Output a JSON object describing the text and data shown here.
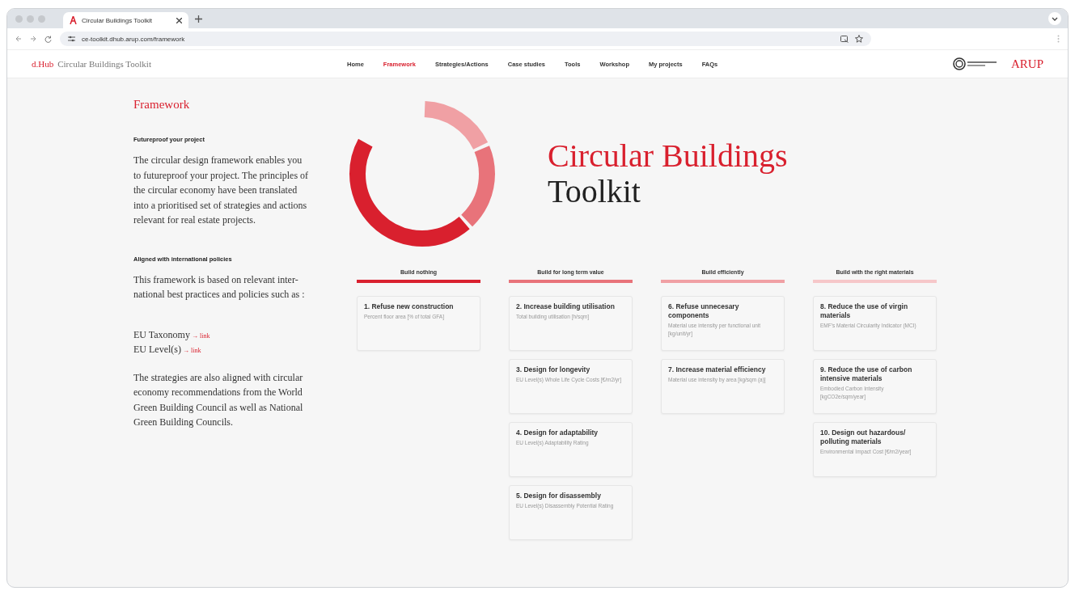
{
  "browser": {
    "tab_title": "Circular Buildings Toolkit",
    "url": "ce-toolkit.dhub.arup.com/framework"
  },
  "header": {
    "brand_mark": "d.Hub",
    "brand_title": "Circular Buildings Toolkit",
    "nav": [
      {
        "label": "Home",
        "selected": false
      },
      {
        "label": "Framework",
        "selected": true
      },
      {
        "label": "Strategies/Actions",
        "selected": false
      },
      {
        "label": "Case studies",
        "selected": false
      },
      {
        "label": "Tools",
        "selected": false
      },
      {
        "label": "Workshop",
        "selected": false
      },
      {
        "label": "My projects",
        "selected": false
      },
      {
        "label": "FAQs",
        "selected": false
      }
    ],
    "company": "ARUP"
  },
  "sidebar": {
    "heading": "Framework",
    "sections": [
      {
        "kind": "subheading",
        "text": "Futureproof your project"
      },
      {
        "kind": "paragraph",
        "text": "The circular design framework enables you to futureproof your project. The principles of the circular economy have been translated into a prioritised set of strategies and actions relevant for real estate projects."
      },
      {
        "kind": "subheading",
        "text": "Aligned with international policies"
      },
      {
        "kind": "paragraph",
        "text": "This framework is based on relevant inter-national best practices and policies such as :"
      },
      {
        "kind": "link",
        "text": "EU Taxonomy",
        "link": "→ link"
      },
      {
        "kind": "link",
        "text": "EU Level(s)",
        "link": "→ link"
      },
      {
        "kind": "paragraph",
        "text": "The strategies are also aligned with circular economy recommendations from the World Green Building Council as well as National Green Building Councils."
      }
    ]
  },
  "hero": {
    "title_line_1": "Circular Buildings",
    "title_line_2": "Toolkit"
  },
  "columns": [
    {
      "title": "Build nothing",
      "color": "#d9202e",
      "cards": [
        {
          "title": "1. Refuse new construction",
          "metric": "Percent floor area [% of total GFA]"
        }
      ]
    },
    {
      "title": "Build for long term value",
      "color": "#e8737a",
      "cards": [
        {
          "title": "2. Increase building utilisation",
          "metric": "Total building utilisation [h/sqm]"
        },
        {
          "title": "3. Design for longevity",
          "metric": "EU Level(s) Whole Life Cycle Costs [€/m2/yr]"
        },
        {
          "title": "4. Design for adaptability",
          "metric": "EU Level(s) Adaptability Rating"
        },
        {
          "title": "5. Design for disassembly",
          "metric": "EU Level(s) Disassembly Potential Rating"
        }
      ]
    },
    {
      "title": "Build efficiently",
      "color": "#f0a0a4",
      "cards": [
        {
          "title": "6. Refuse unnecesary components",
          "metric": "Material use intensity per functional unit [kg/unit/yr]"
        },
        {
          "title": "7. Increase material efficiency",
          "metric": "Material use intensity by area [kg/sqm (a)]"
        }
      ]
    },
    {
      "title": "Build with the right materials",
      "color": "#f6c7c9",
      "cards": [
        {
          "title": "8. Reduce the use of virgin materials",
          "metric": "EMF's Material Circularity Indicator (MCI)"
        },
        {
          "title": "9. Reduce the use of carbon intensive materials",
          "metric": "Embodied Carbon Intensity [kgCO2e/sqm/year]"
        },
        {
          "title": "10. Design out hazardous/ polluting materials",
          "metric": "Environmental Impact Cost [€/m2/year]"
        }
      ]
    }
  ]
}
